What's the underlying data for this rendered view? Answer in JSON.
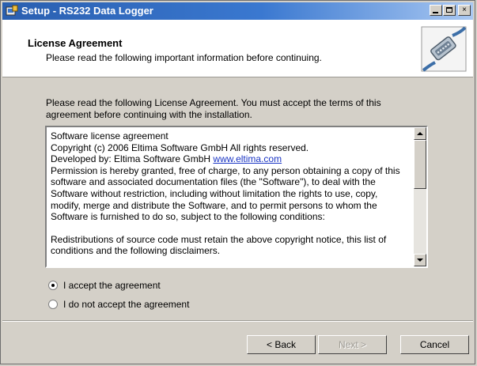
{
  "window": {
    "title": "Setup - RS232 Data Logger",
    "icon": "setup-app-icon",
    "controls": [
      "minimize-icon",
      "maximize-icon",
      "close-icon"
    ],
    "close_glyph": "×",
    "title_gradient": [
      "#2a5fb0",
      "#a9c8f2"
    ]
  },
  "header": {
    "title": "License Agreement",
    "subtitle": "Please read the following important information before continuing.",
    "icon": "serial-cable-icon"
  },
  "intro": "Please read the following License Agreement. You must accept the terms of this agreement before continuing with the installation.",
  "license": {
    "line1": "Software license agreement",
    "line2": "Copyright (c) 2006 Eltima Software GmbH All rights reserved.",
    "line3_prefix": "Developed by: Eltima Software GmbH ",
    "line3_link": "www.eltima.com",
    "para1": "Permission is hereby granted, free of charge, to any person obtaining a copy of this software and associated documentation files (the \"Software\"), to deal with the Software without restriction, including without limitation the rights to use, copy, modify, merge and distribute the Software, and to permit persons to whom the Software is furnished to do so, subject to the following conditions:",
    "para2": "Redistributions of source code must retain the above copyright notice, this list of conditions and the following disclaimers.",
    "link_color": "#1a35c4"
  },
  "options": {
    "accept": {
      "label": "I accept the agreement",
      "selected": true
    },
    "decline": {
      "label": "I do not accept the agreement",
      "selected": false
    }
  },
  "buttons": {
    "back": "< Back",
    "next": "Next >",
    "cancel": "Cancel"
  }
}
